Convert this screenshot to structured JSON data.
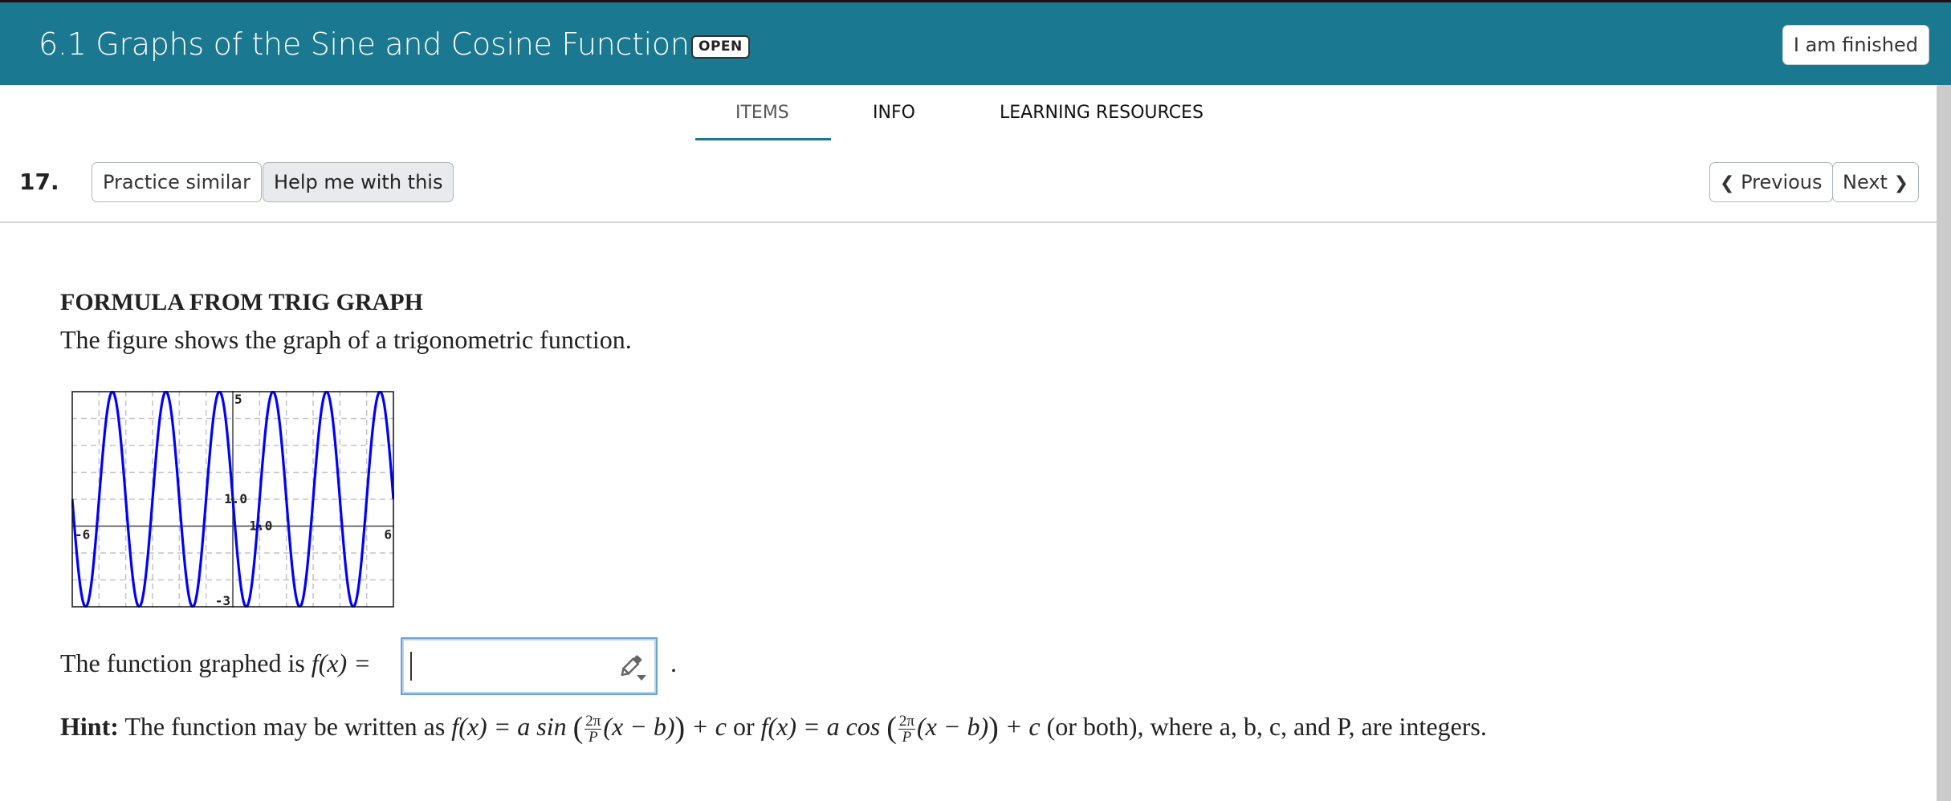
{
  "header": {
    "title": "6.1 Graphs of the Sine and Cosine Functions",
    "status_badge": "OPEN",
    "finish_button": "I am finished",
    "bar_color": "#1b7891"
  },
  "tabs": [
    {
      "label": "ITEMS",
      "active": true
    },
    {
      "label": "INFO",
      "active": false
    },
    {
      "label": "LEARNING RESOURCES",
      "active": false
    }
  ],
  "question_bar": {
    "number": "17.",
    "practice_similar": "Practice similar",
    "help_me": "Help me with this",
    "previous": "Previous",
    "next": "Next"
  },
  "problem": {
    "heading": "FORMULA FROM TRIG GRAPH",
    "description": "The figure shows the graph of a trigonometric function.",
    "answer_prefix": "The function graphed is ",
    "answer_fx": "f(x) =",
    "answer_value": "",
    "answer_suffix": ".",
    "hint_label": "Hint:",
    "hint_text_1": "The function may be written as",
    "hint_formula_sin": "f(x) = a sin",
    "hint_formula_cos": "f(x) = a cos",
    "hint_frac_num": "2π",
    "hint_frac_den": "P",
    "hint_inner": "(x − b)",
    "hint_plus_c": "+ c",
    "hint_or": "or",
    "hint_tail": "(or both), where a, b, c, and P, are integers."
  },
  "chart_data": {
    "type": "line",
    "title": "",
    "xlabel": "",
    "ylabel": "",
    "xlim": [
      -6,
      6
    ],
    "ylim": [
      -3,
      5
    ],
    "grid": true,
    "grid_step_x": 1,
    "grid_step_y": 1,
    "tick_labels": {
      "x_min": "-6",
      "x_max": "6",
      "y_min": "-3",
      "y_max": "5",
      "x_unit": "1.0",
      "y_unit": "1.0"
    },
    "series": [
      {
        "name": "f(x)",
        "color": "#0000ff",
        "function": "-4*sin(pi*x)+1",
        "amplitude": 4,
        "period": 2,
        "midline": 1,
        "max": 5,
        "min": -3
      }
    ]
  }
}
